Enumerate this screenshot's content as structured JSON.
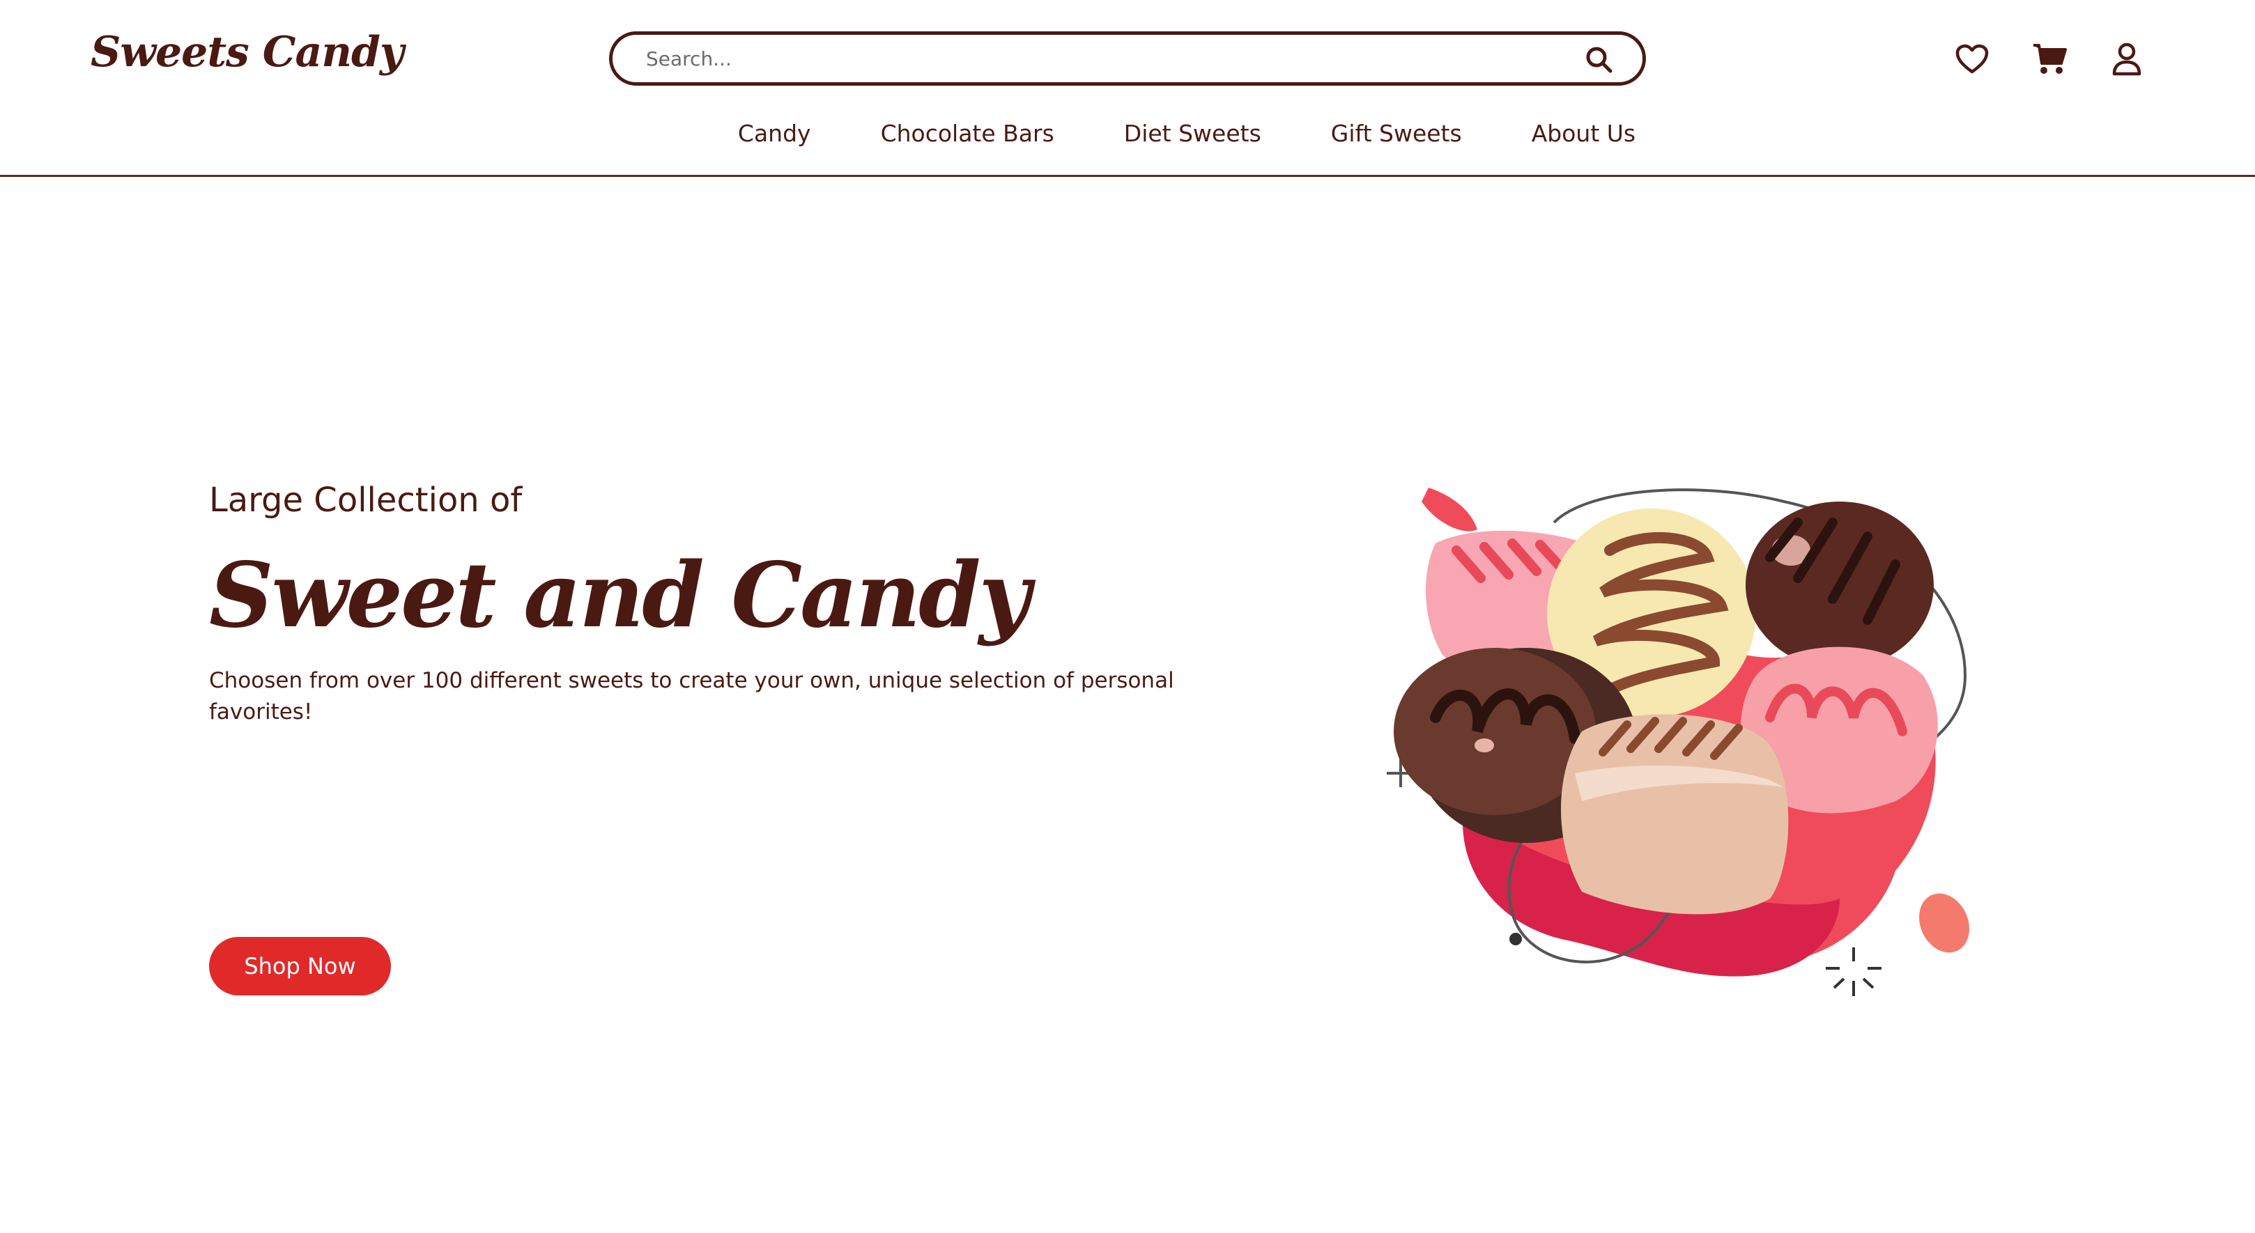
{
  "header": {
    "logo": "Sweets Candy",
    "search": {
      "placeholder": "Search..."
    },
    "icons": [
      "heart-icon",
      "cart-icon",
      "user-icon"
    ]
  },
  "nav": {
    "items": [
      "Candy",
      "Chocolate Bars",
      "Diet Sweets",
      "Gift Sweets",
      "About Us"
    ]
  },
  "hero": {
    "subtitle": "Large Collection of",
    "title": "Sweet and Candy",
    "description": "Choosen from over 100 different sweets to create your own, unique selection of personal favorites!",
    "cta": "Shop Now"
  },
  "colors": {
    "brand": "#4a1a12",
    "accent": "#e02a2a",
    "background": "#ffffff"
  }
}
